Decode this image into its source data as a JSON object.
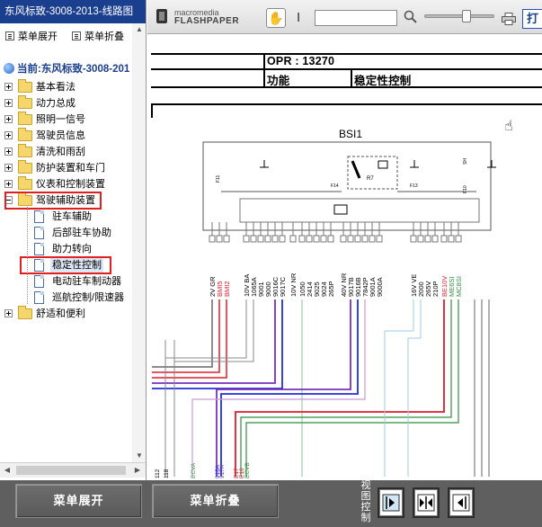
{
  "left_panel": {
    "title": "东风标致-3008-2013-线路图",
    "toolbar": {
      "expand_label": "菜单展开",
      "collapse_label": "菜单折叠"
    },
    "current": "当前:东风标致-3008-201",
    "items": [
      {
        "label": "基本看法",
        "level": 0,
        "expander": "plus"
      },
      {
        "label": "动力总成",
        "level": 0,
        "expander": "plus"
      },
      {
        "label": "照明一信号",
        "level": 0,
        "expander": "plus"
      },
      {
        "label": "驾驶员信息",
        "level": 0,
        "expander": "plus"
      },
      {
        "label": "清洗和雨刮",
        "level": 0,
        "expander": "plus"
      },
      {
        "label": "防护装置和车门",
        "level": 0,
        "expander": "plus"
      },
      {
        "label": "仪表和控制装置",
        "level": 0,
        "expander": "plus"
      },
      {
        "label": "驾驶辅助装置",
        "level": 0,
        "expander": "minus",
        "highlighted": true
      },
      {
        "label": "驻车辅助",
        "level": 1
      },
      {
        "label": "后部驻车协助",
        "level": 1
      },
      {
        "label": "助力转向",
        "level": 1
      },
      {
        "label": "稳定性控制",
        "level": 1,
        "selected": true,
        "highlighted": true
      },
      {
        "label": "电动驻车制动器",
        "level": 1
      },
      {
        "label": "巡航控制/限速器",
        "level": 1
      },
      {
        "label": "舒适和便利",
        "level": 0,
        "expander": "plus"
      }
    ]
  },
  "viewer": {
    "brand_top": "macromedia",
    "brand_bottom": "FLASHPAPER",
    "print_label": "打",
    "doc": {
      "opr_label": "OPR : 13270",
      "function_label": "功能",
      "function_value": "稳定性控制",
      "box_title": "BSI1",
      "pin_labels_left": [
        "2V GR",
        "BMI5",
        "BMI2",
        "10V BA",
        "1065A",
        "9001",
        "9000",
        "9016C",
        "9017C",
        "10V NR",
        "1050",
        "2414",
        "9025",
        "9024",
        "265P",
        "40V NR",
        "9017B",
        "9016B",
        "7842P",
        "9001A",
        "9000A"
      ],
      "pin_labels_right": [
        "16V VE",
        "2000",
        "265V",
        "210P",
        "BE10V",
        "ME6SI",
        "MC8SI"
      ],
      "bottom_labels": [
        "112",
        "118",
        "ECVA",
        "918A",
        "917A",
        "E17",
        "E16",
        "ECVB"
      ],
      "fuse_labels": [
        "F11",
        "F14",
        "F13",
        "R7",
        "F10",
        "SH"
      ]
    },
    "colors": {
      "accent": "#1b3f8f",
      "highlight": "#e21f1f",
      "wire_blue": "#1f2fd6",
      "wire_purple": "#7a2fbf",
      "wire_red": "#e01b2b",
      "wire_green": "#2f8f3f"
    }
  },
  "bottom_bar": {
    "expand_label": "菜单展开",
    "collapse_label": "菜单折叠",
    "view_control_label": "视图控制"
  }
}
